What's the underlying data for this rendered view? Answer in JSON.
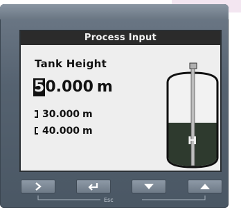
{
  "screen": {
    "title": "Process Input",
    "parameter_label": "Tank Height",
    "value": {
      "cursor_digit": "5",
      "rest": "0.000",
      "unit": "m"
    },
    "low_limit": {
      "value": "30.000",
      "unit": "m"
    },
    "high_limit": {
      "value": "40.000",
      "unit": "m"
    },
    "tank_marker": "H"
  },
  "keypad": {
    "keys": [
      {
        "icon": "right-arrow-icon"
      },
      {
        "icon": "enter-icon"
      },
      {
        "icon": "down-arrow-icon"
      },
      {
        "icon": "up-arrow-icon"
      }
    ],
    "esc_label": "Esc"
  },
  "colors": {
    "bezel": "#556270",
    "lcd_background": "#eeeeee",
    "lcd_text": "#111111",
    "title_bar": "#2b2b2b",
    "liquid": "#2e3a2e"
  }
}
